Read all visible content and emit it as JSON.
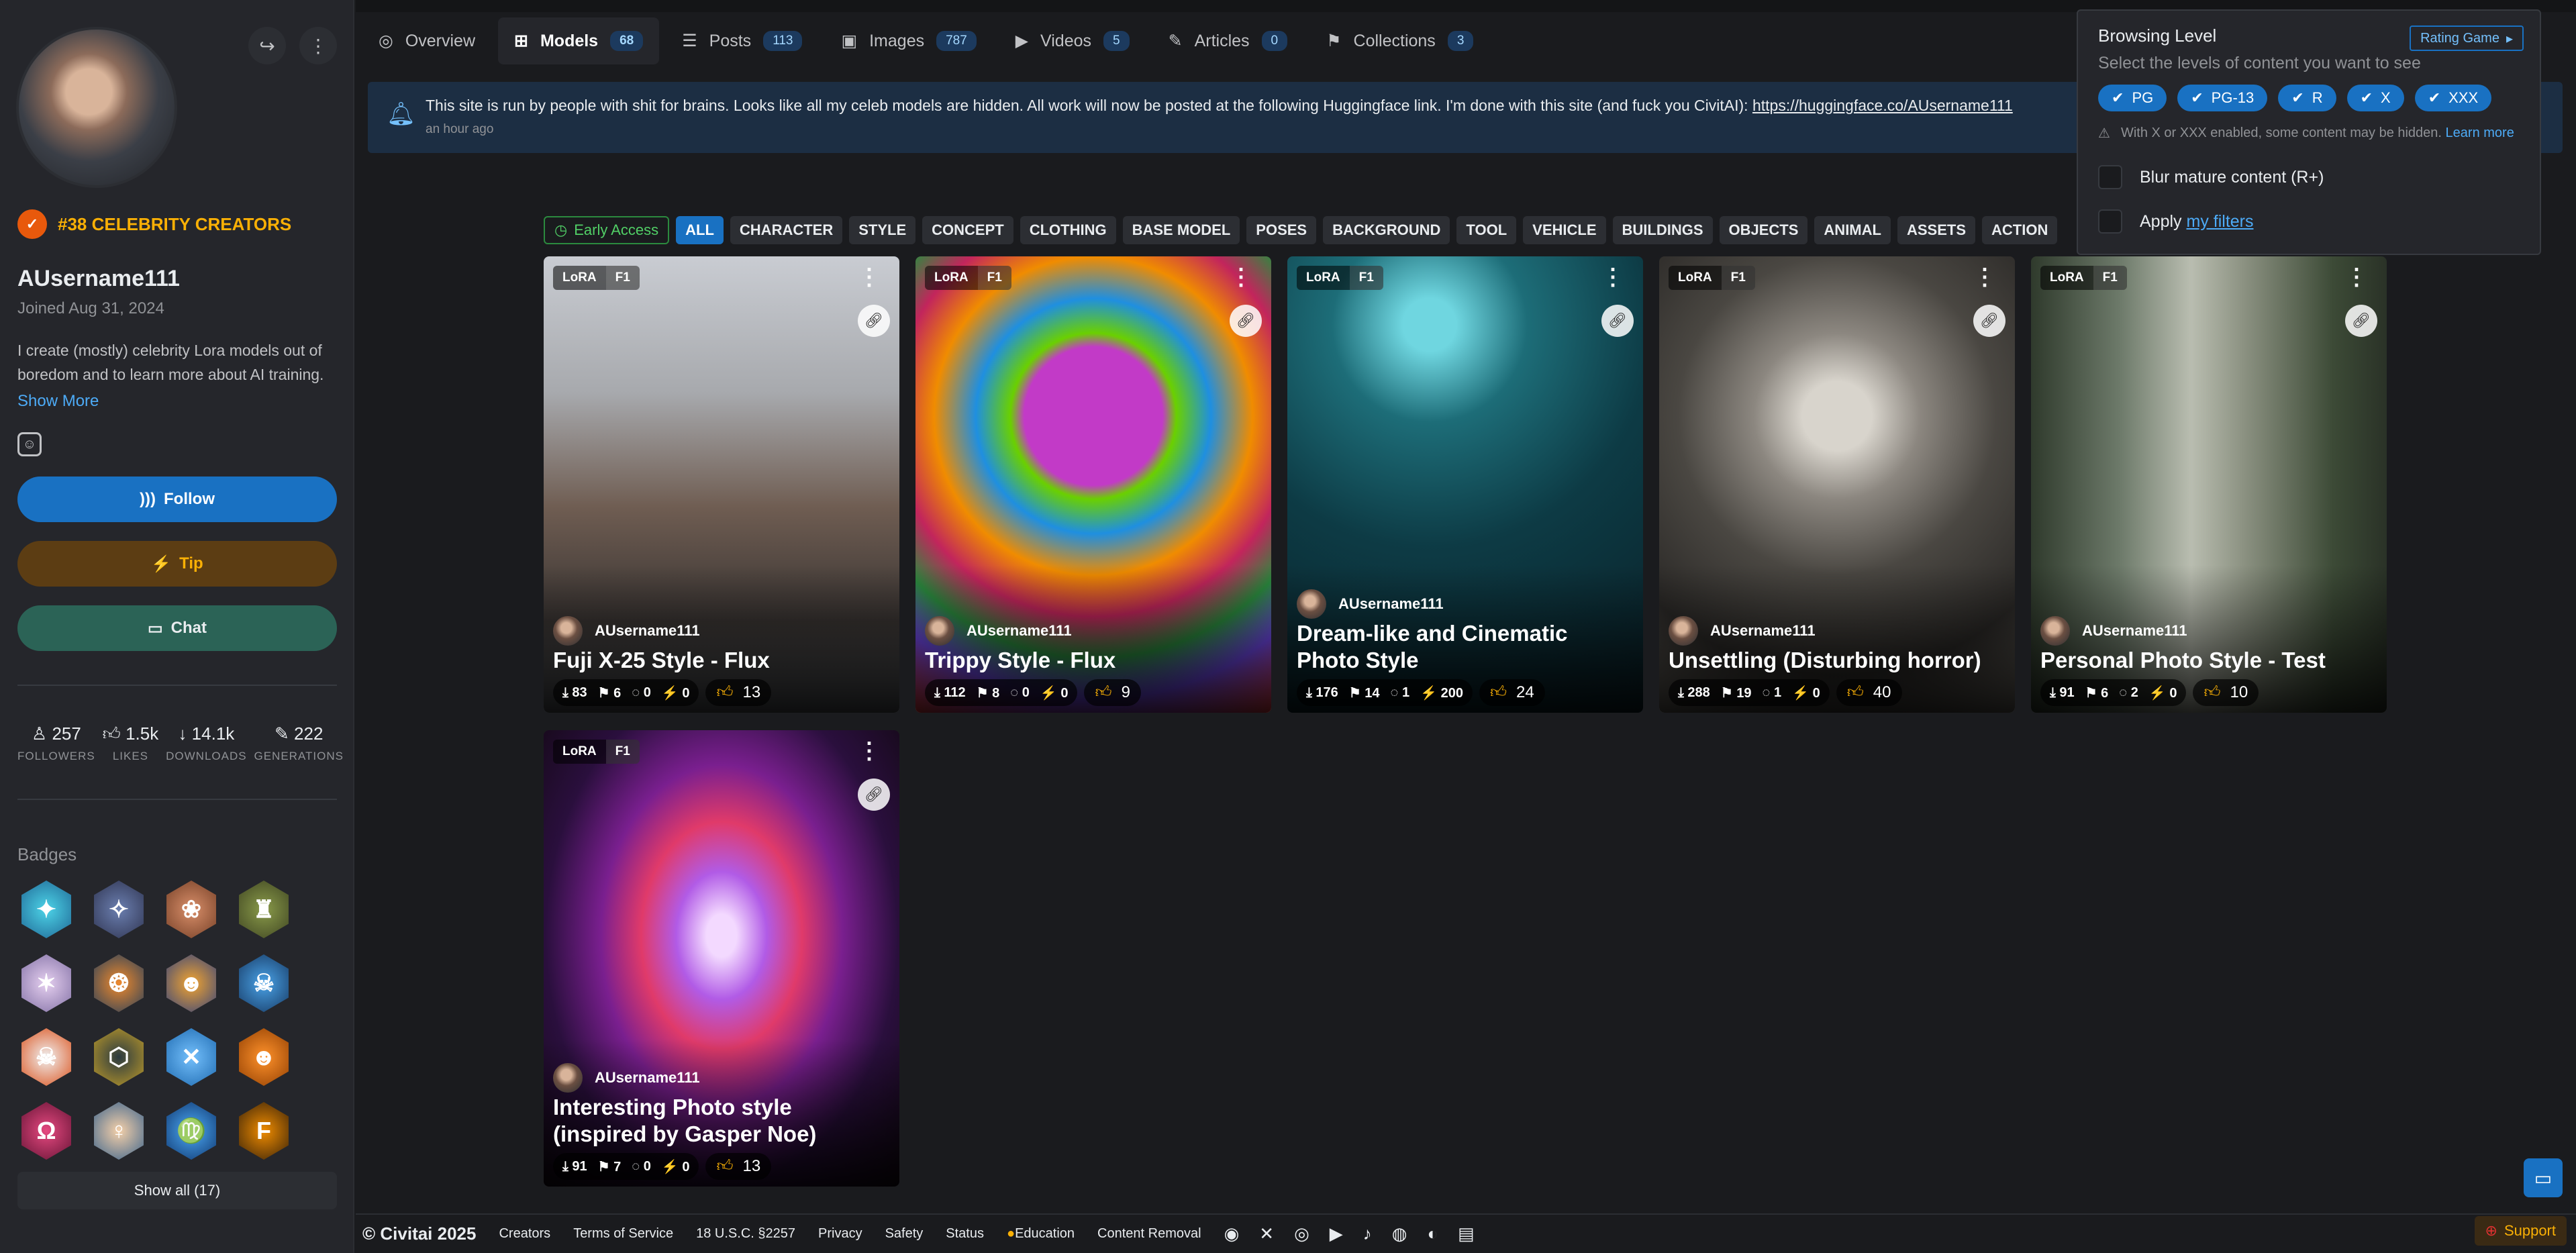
{
  "sidebar": {
    "rank": "#38 CELEBRITY CREATORS",
    "username": "AUsername111",
    "joined": "Joined Aug 31, 2024",
    "bio": "I create (mostly) celebrity Lora models out of boredom and to learn more about AI training.",
    "show_more": "Show More",
    "follow": "Follow",
    "tip": "Tip",
    "chat": "Chat",
    "stats": [
      {
        "value": "257",
        "label": "FOLLOWERS"
      },
      {
        "value": "1.5k",
        "label": "LIKES"
      },
      {
        "value": "14.1k",
        "label": "DOWNLOADS"
      },
      {
        "value": "222",
        "label": "GENERATIONS"
      }
    ],
    "badges_title": "Badges",
    "show_all": "Show all (17)"
  },
  "tabs": [
    {
      "label": "Overview",
      "count": ""
    },
    {
      "label": "Models",
      "count": "68"
    },
    {
      "label": "Posts",
      "count": "113"
    },
    {
      "label": "Images",
      "count": "787"
    },
    {
      "label": "Videos",
      "count": "5"
    },
    {
      "label": "Articles",
      "count": "0"
    },
    {
      "label": "Collections",
      "count": "3"
    }
  ],
  "banner": {
    "text": "This site is run by people with shit for brains. Looks like all my celeb models are hidden. All work will now be posted at the following Huggingface link. I'm done with this site (and fuck you CivitAI):",
    "link": "https://huggingface.co/AUsername111",
    "time": "an hour ago"
  },
  "filters": {
    "early_access": "Early Access",
    "chips": [
      "ALL",
      "CHARACTER",
      "STYLE",
      "CONCEPT",
      "CLOTHING",
      "BASE MODEL",
      "POSES",
      "BACKGROUND",
      "TOOL",
      "VEHICLE",
      "BUILDINGS",
      "OBJECTS",
      "ANIMAL",
      "ASSETS",
      "ACTION"
    ]
  },
  "cards": [
    {
      "type": "LoRA",
      "base": "F1",
      "creator": "AUsername111",
      "title": "Fuji X-25 Style - Flux",
      "downloads": "83",
      "saves": "6",
      "comments": "0",
      "buzz": "0",
      "likes": "13"
    },
    {
      "type": "LoRA",
      "base": "F1",
      "creator": "AUsername111",
      "title": "Trippy Style - Flux",
      "downloads": "112",
      "saves": "8",
      "comments": "0",
      "buzz": "0",
      "likes": "9"
    },
    {
      "type": "LoRA",
      "base": "F1",
      "creator": "AUsername111",
      "title": "Dream-like and Cinematic Photo Style",
      "downloads": "176",
      "saves": "14",
      "comments": "1",
      "buzz": "200",
      "likes": "24"
    },
    {
      "type": "LoRA",
      "base": "F1",
      "creator": "AUsername111",
      "title": "Unsettling (Disturbing horror)",
      "downloads": "288",
      "saves": "19",
      "comments": "1",
      "buzz": "0",
      "likes": "40"
    },
    {
      "type": "LoRA",
      "base": "F1",
      "creator": "AUsername111",
      "title": "Personal Photo Style - Test",
      "downloads": "91",
      "saves": "6",
      "comments": "2",
      "buzz": "0",
      "likes": "10"
    },
    {
      "type": "LoRA",
      "base": "F1",
      "creator": "AUsername111",
      "title": "Interesting Photo style (inspired by Gasper Noe)",
      "downloads": "91",
      "saves": "7",
      "comments": "0",
      "buzz": "0",
      "likes": "13"
    }
  ],
  "popover": {
    "title": "Browsing Level",
    "rating_game": "Rating Game",
    "subtitle": "Select the levels of content you want to see",
    "levels": [
      "PG",
      "PG-13",
      "R",
      "X",
      "XXX"
    ],
    "warning": "With X or XXX enabled, some content may be hidden.",
    "learn_more": "Learn more",
    "blur": "Blur mature content (R+)",
    "apply": "Apply",
    "my_filters": "my filters"
  },
  "footer": {
    "copyright": "© Civitai 2025",
    "links": [
      "Creators",
      "Terms of Service",
      "18 U.S.C. §2257",
      "Privacy",
      "Safety",
      "Status",
      "Education",
      "Content Removal"
    ],
    "support": "Support"
  },
  "colors": {
    "accent": "#1971c2",
    "gold": "#fab005",
    "background": "#1a1b1e",
    "panel": "#25262b"
  }
}
